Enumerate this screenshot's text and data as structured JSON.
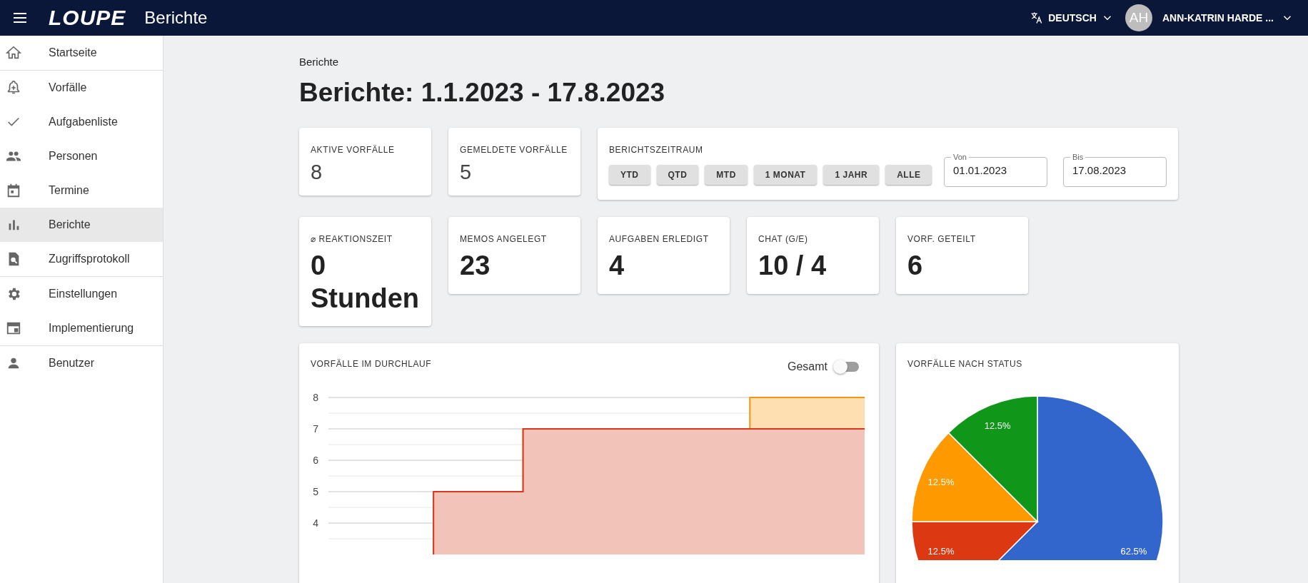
{
  "header": {
    "logo": "LOUPE",
    "title": "Berichte",
    "language": "DEUTSCH",
    "user": {
      "initials": "AH",
      "name": "ANN-KATRIN HARDE ..."
    }
  },
  "sidebar": {
    "items": [
      {
        "label": "Startseite",
        "kind": "home",
        "selected": false,
        "divider": true
      },
      {
        "label": "Vorfälle",
        "kind": "bell",
        "selected": false,
        "divider": false
      },
      {
        "label": "Aufgabenliste",
        "kind": "check",
        "selected": false,
        "divider": false
      },
      {
        "label": "Personen",
        "kind": "people",
        "selected": false,
        "divider": false
      },
      {
        "label": "Termine",
        "kind": "calendar",
        "selected": false,
        "divider": false
      },
      {
        "label": "Berichte",
        "kind": "bars",
        "selected": true,
        "divider": false
      },
      {
        "label": "Zugriffsprotokoll",
        "kind": "search-doc",
        "selected": false,
        "divider": true
      },
      {
        "label": "Einstellungen",
        "kind": "gear",
        "selected": false,
        "divider": false
      },
      {
        "label": "Implementierung",
        "kind": "window",
        "selected": false,
        "divider": true
      },
      {
        "label": "Benutzer",
        "kind": "person",
        "selected": false,
        "divider": false
      }
    ]
  },
  "breadcrumb": "Berichte",
  "page_title": "Berichte: 1.1.2023 - 17.8.2023",
  "stats_top": [
    {
      "label": "AKTIVE VORFÄLLE",
      "value": "8"
    },
    {
      "label": "GEMELDETE VORFÄLLE",
      "value": "5"
    }
  ],
  "report_period": {
    "label": "BERICHTSZEITRAUM",
    "buttons": [
      "YTD",
      "QTD",
      "MTD",
      "1 MONAT",
      "1 JAHR",
      "ALLE"
    ],
    "from": {
      "label": "Von",
      "value": "01.01.2023"
    },
    "to": {
      "label": "Bis",
      "value": "17.08.2023"
    }
  },
  "stats": [
    {
      "label": "⌀ REAKTIONSZEIT",
      "value": "0 Stunden"
    },
    {
      "label": "MEMOS ANGELEGT",
      "value": "23"
    },
    {
      "label": "AUFGABEN ERLEDIGT",
      "value": "4"
    },
    {
      "label": "CHAT (G/E)",
      "value": "10 / 4"
    },
    {
      "label": "VORF. GETEILT",
      "value": "6"
    }
  ],
  "throughput": {
    "title": "VORFÄLLE IM DURCHLAUF",
    "toggle": {
      "label": "Gesamt",
      "on": false
    },
    "y_axis_labels": [
      "8",
      "7",
      "6",
      "5",
      "4"
    ]
  },
  "status": {
    "title": "VORFÄLLE NACH STATUS",
    "chart_data": {
      "type": "pie",
      "values": [
        62.5,
        12.5,
        12.5,
        12.5
      ],
      "colors": [
        "#3366cc",
        "#dc3912",
        "#ff9900",
        "#109618"
      ],
      "value_labels": [
        "62.5%",
        "12.5%",
        "12.5%",
        "12.5%"
      ]
    }
  }
}
